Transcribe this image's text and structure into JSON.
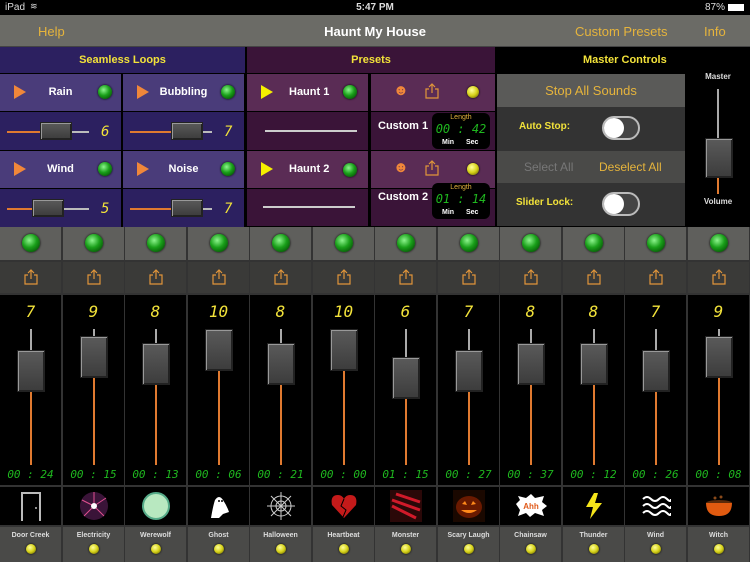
{
  "status_bar": {
    "device": "iPad",
    "time": "5:47 PM",
    "battery": "87%"
  },
  "nav": {
    "help": "Help",
    "title": "Haunt My House",
    "custom_presets": "Custom Presets",
    "info": "Info"
  },
  "sections": {
    "loops": "Seamless Loops",
    "presets": "Presets",
    "master": "Master Controls"
  },
  "loops": [
    {
      "name": "Rain",
      "level": "6",
      "fraction": 0.6
    },
    {
      "name": "Bubbling",
      "level": "7",
      "fraction": 0.7
    },
    {
      "name": "Wind",
      "level": "5",
      "fraction": 0.5
    },
    {
      "name": "Noise",
      "level": "7",
      "fraction": 0.7
    }
  ],
  "presets": [
    {
      "name": "Haunt 1",
      "custom": "Custom 1",
      "length_label": "Length",
      "length": "00 : 42",
      "min": "Min",
      "sec": "Sec"
    },
    {
      "name": "Haunt 2",
      "custom": "Custom 2",
      "length_label": "Length",
      "length": "01 : 14",
      "min": "Min",
      "sec": "Sec"
    }
  ],
  "master": {
    "stop_all": "Stop All Sounds",
    "auto_stop": "Auto Stop:",
    "auto_stop_on": false,
    "select_all": "Select All",
    "deselect_all": "Deselect All",
    "slider_lock": "Slider Lock:",
    "slider_lock_on": false,
    "volume_top": "Master",
    "volume_bottom": "Volume",
    "volume_fraction": 0.25
  },
  "channels": [
    {
      "name": "Door Creek",
      "level": "7",
      "time": "00 : 24",
      "icon": "door-icon"
    },
    {
      "name": "Electricity",
      "level": "9",
      "time": "00 : 15",
      "icon": "plasma-ball-icon"
    },
    {
      "name": "Werewolf",
      "level": "8",
      "time": "00 : 13",
      "icon": "full-moon-icon"
    },
    {
      "name": "Ghost",
      "level": "10",
      "time": "00 : 06",
      "icon": "ghost-icon"
    },
    {
      "name": "Halloween",
      "level": "8",
      "time": "00 : 21",
      "icon": "spiderweb-icon"
    },
    {
      "name": "Heartbeat",
      "level": "10",
      "time": "00 : 00",
      "icon": "broken-heart-icon"
    },
    {
      "name": "Monster",
      "level": "6",
      "time": "01 : 15",
      "icon": "monster-claw-icon"
    },
    {
      "name": "Scary Laugh",
      "level": "7",
      "time": "00 : 27",
      "icon": "jack-o-lantern-icon"
    },
    {
      "name": "Chainsaw",
      "level": "8",
      "time": "00 : 37",
      "icon": "ahh-burst-icon"
    },
    {
      "name": "Thunder",
      "level": "8",
      "time": "00 : 12",
      "icon": "lightning-icon"
    },
    {
      "name": "Wind",
      "level": "7",
      "time": "00 : 26",
      "icon": "wind-waves-icon"
    },
    {
      "name": "Witch",
      "level": "9",
      "time": "00 : 08",
      "icon": "cauldron-icon"
    }
  ],
  "colors": {
    "accent": "#e6b43c",
    "lcd_yellow": "#f2e23a",
    "lcd_green": "#1fb81f",
    "slider_orange": "#e07a30"
  }
}
